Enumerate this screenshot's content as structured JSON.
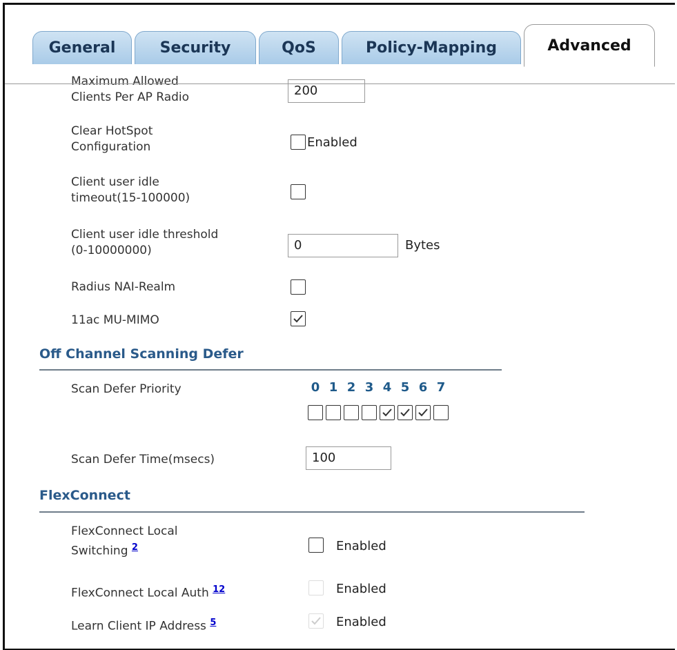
{
  "tabs": [
    {
      "label": "General",
      "active": false
    },
    {
      "label": "Security",
      "active": false
    },
    {
      "label": "QoS",
      "active": false
    },
    {
      "label": "Policy-Mapping",
      "active": false
    },
    {
      "label": "Advanced",
      "active": true
    }
  ],
  "advanced": {
    "max_clients_label_1": "Maximum Allowed",
    "max_clients_label_2": "Clients Per AP Radio",
    "max_clients_value": "200",
    "clear_hotspot_label_1": "Clear HotSpot",
    "clear_hotspot_label_2": "Configuration",
    "clear_hotspot_option": "Enabled",
    "clear_hotspot_checked": false,
    "idle_timeout_label_1": "Client user idle",
    "idle_timeout_label_2": "timeout(15-100000)",
    "idle_timeout_checked": false,
    "idle_threshold_label_1": "Client user idle threshold",
    "idle_threshold_label_2": "(0-10000000)",
    "idle_threshold_value": "0",
    "idle_threshold_unit": "Bytes",
    "radius_label": "Radius NAI-Realm",
    "radius_checked": false,
    "mu_mimo_label": "11ac MU-MIMO",
    "mu_mimo_checked": true
  },
  "off_channel": {
    "title": "Off Channel Scanning Defer",
    "priority_label": "Scan Defer Priority",
    "priorities": [
      {
        "n": "0",
        "checked": false
      },
      {
        "n": "1",
        "checked": false
      },
      {
        "n": "2",
        "checked": false
      },
      {
        "n": "3",
        "checked": false
      },
      {
        "n": "4",
        "checked": true
      },
      {
        "n": "5",
        "checked": true
      },
      {
        "n": "6",
        "checked": true
      },
      {
        "n": "7",
        "checked": false
      }
    ],
    "defer_time_label": "Scan Defer Time(msecs)",
    "defer_time_value": "100"
  },
  "flexconnect": {
    "title": "FlexConnect",
    "local_switching_label_1": "FlexConnect Local",
    "local_switching_label_2": "Switching",
    "local_switching_note": "2",
    "local_switching_option": "Enabled",
    "local_auth_label": "FlexConnect Local Auth",
    "local_auth_note": "12",
    "local_auth_option": "Enabled",
    "learn_ip_label": "Learn Client IP Address",
    "learn_ip_note": "5",
    "learn_ip_option": "Enabled"
  }
}
